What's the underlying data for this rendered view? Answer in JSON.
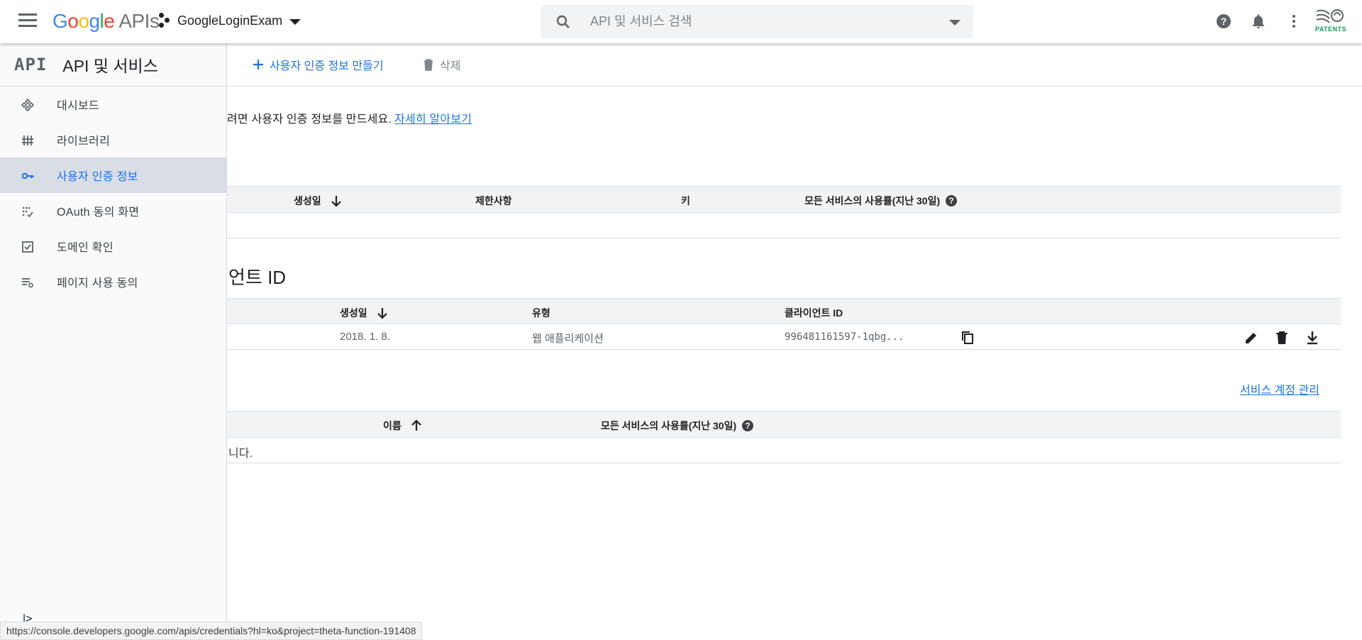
{
  "header": {
    "logo_google": "Google",
    "logo_apis": "APIs",
    "project_name": "GoogleLoginExam",
    "search_placeholder": "API 및 서비스 검색",
    "patent_badge": "PATENTS"
  },
  "sidebar": {
    "mark": "API",
    "title": "API 및 서비스",
    "items": [
      {
        "label": "대시보드",
        "icon": "dashboard-icon",
        "active": false
      },
      {
        "label": "라이브러리",
        "icon": "library-icon",
        "active": false
      },
      {
        "label": "사용자 인증 정보",
        "icon": "key-icon",
        "active": true
      },
      {
        "label": "OAuth 동의 화면",
        "icon": "oauth-consent-icon",
        "active": false
      },
      {
        "label": "도메인 확인",
        "icon": "checkbox-icon",
        "active": false
      },
      {
        "label": "페이지 사용 동의",
        "icon": "settings-list-icon",
        "active": false
      }
    ],
    "collapse_glyph": "|>"
  },
  "toolbar": {
    "create_label": "사용자 인증 정보 만들기",
    "delete_label": "삭제"
  },
  "intro": {
    "text": "려면 사용자 인증 정보를 만드세요.",
    "link": "자세히 알아보기"
  },
  "api_keys_table": {
    "columns": [
      "생성일",
      "제한사항",
      "키",
      "모든 서비스의 사용률(지난 30일)"
    ]
  },
  "oauth_section": {
    "title": "언트 ID",
    "columns": [
      "생성일",
      "유형",
      "클라이언트 ID"
    ],
    "rows": [
      {
        "created": "2018. 1. 8.",
        "type": "웹 애플리케이션",
        "client_id": "996481161597-1qbg..."
      }
    ]
  },
  "service_accounts": {
    "manage_link": "서비스 계정 관리",
    "columns": [
      "이름",
      "모든 서비스의 사용률(지난 30일)"
    ],
    "empty_text": "니다."
  },
  "status_bar": {
    "url": "https://console.developers.google.com/apis/credentials?hl=ko&project=theta-function-191408"
  },
  "colors": {
    "accent": "#1a73e8",
    "active_nav_bg": "#d8dde6",
    "table_header_bg": "#f1f3f4",
    "patent_green": "#0f9d58"
  }
}
